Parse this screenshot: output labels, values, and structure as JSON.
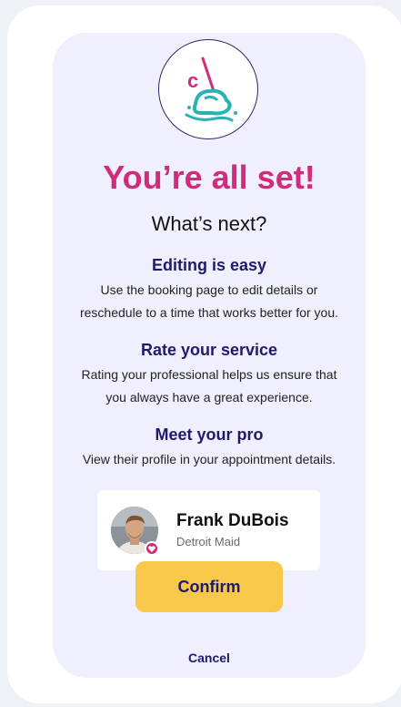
{
  "header": {
    "title": "You’re all set!",
    "subtitle": "What’s next?"
  },
  "sections": [
    {
      "heading": "Editing is easy",
      "body_line1": "Use the booking page to edit details or",
      "body_line2": "reschedule to a time that works better for you."
    },
    {
      "heading": "Rate your service",
      "body_line1": "Rating your professional helps us ensure that",
      "body_line2": "you always have a great experience."
    },
    {
      "heading": "Meet your pro",
      "body_line1": "View their profile in your appointment details."
    }
  ],
  "pro": {
    "name": "Frank DuBois",
    "company": "Detroit Maid",
    "badge_icon": "heart-icon"
  },
  "actions": {
    "confirm_label": "Confirm",
    "cancel_label": "Cancel"
  },
  "colors": {
    "accent_pink": "#d12c7c",
    "navy": "#1f1a6b",
    "button_yellow": "#f7c84a",
    "card_bg": "#efeffd",
    "logo_teal": "#27b3b4"
  },
  "icons": {
    "logo": "cleaning-mop-logo-icon"
  }
}
